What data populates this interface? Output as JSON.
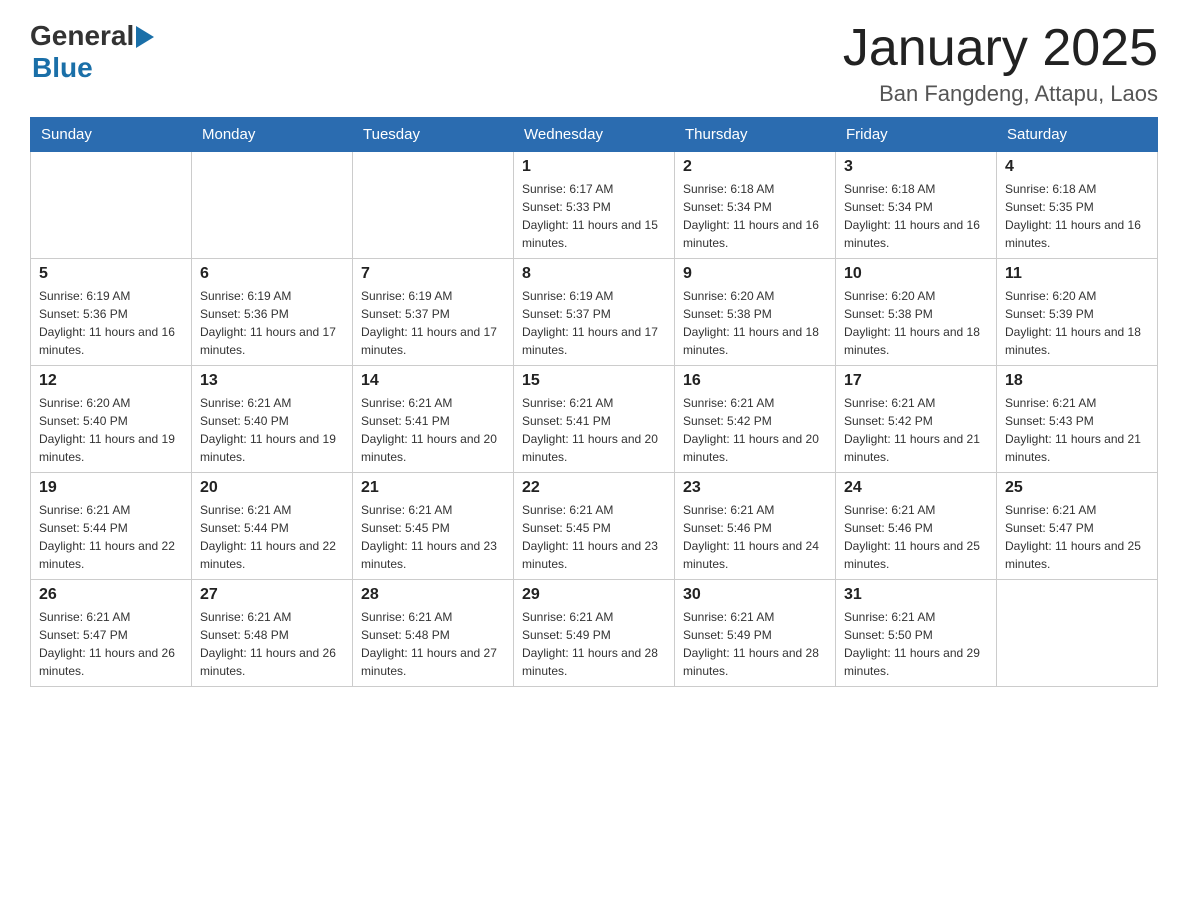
{
  "header": {
    "logo_general": "General",
    "logo_blue": "Blue",
    "month_title": "January 2025",
    "location": "Ban Fangdeng, Attapu, Laos"
  },
  "weekdays": [
    "Sunday",
    "Monday",
    "Tuesday",
    "Wednesday",
    "Thursday",
    "Friday",
    "Saturday"
  ],
  "weeks": [
    [
      {
        "day": "",
        "info": ""
      },
      {
        "day": "",
        "info": ""
      },
      {
        "day": "",
        "info": ""
      },
      {
        "day": "1",
        "info": "Sunrise: 6:17 AM\nSunset: 5:33 PM\nDaylight: 11 hours and 15 minutes."
      },
      {
        "day": "2",
        "info": "Sunrise: 6:18 AM\nSunset: 5:34 PM\nDaylight: 11 hours and 16 minutes."
      },
      {
        "day": "3",
        "info": "Sunrise: 6:18 AM\nSunset: 5:34 PM\nDaylight: 11 hours and 16 minutes."
      },
      {
        "day": "4",
        "info": "Sunrise: 6:18 AM\nSunset: 5:35 PM\nDaylight: 11 hours and 16 minutes."
      }
    ],
    [
      {
        "day": "5",
        "info": "Sunrise: 6:19 AM\nSunset: 5:36 PM\nDaylight: 11 hours and 16 minutes."
      },
      {
        "day": "6",
        "info": "Sunrise: 6:19 AM\nSunset: 5:36 PM\nDaylight: 11 hours and 17 minutes."
      },
      {
        "day": "7",
        "info": "Sunrise: 6:19 AM\nSunset: 5:37 PM\nDaylight: 11 hours and 17 minutes."
      },
      {
        "day": "8",
        "info": "Sunrise: 6:19 AM\nSunset: 5:37 PM\nDaylight: 11 hours and 17 minutes."
      },
      {
        "day": "9",
        "info": "Sunrise: 6:20 AM\nSunset: 5:38 PM\nDaylight: 11 hours and 18 minutes."
      },
      {
        "day": "10",
        "info": "Sunrise: 6:20 AM\nSunset: 5:38 PM\nDaylight: 11 hours and 18 minutes."
      },
      {
        "day": "11",
        "info": "Sunrise: 6:20 AM\nSunset: 5:39 PM\nDaylight: 11 hours and 18 minutes."
      }
    ],
    [
      {
        "day": "12",
        "info": "Sunrise: 6:20 AM\nSunset: 5:40 PM\nDaylight: 11 hours and 19 minutes."
      },
      {
        "day": "13",
        "info": "Sunrise: 6:21 AM\nSunset: 5:40 PM\nDaylight: 11 hours and 19 minutes."
      },
      {
        "day": "14",
        "info": "Sunrise: 6:21 AM\nSunset: 5:41 PM\nDaylight: 11 hours and 20 minutes."
      },
      {
        "day": "15",
        "info": "Sunrise: 6:21 AM\nSunset: 5:41 PM\nDaylight: 11 hours and 20 minutes."
      },
      {
        "day": "16",
        "info": "Sunrise: 6:21 AM\nSunset: 5:42 PM\nDaylight: 11 hours and 20 minutes."
      },
      {
        "day": "17",
        "info": "Sunrise: 6:21 AM\nSunset: 5:42 PM\nDaylight: 11 hours and 21 minutes."
      },
      {
        "day": "18",
        "info": "Sunrise: 6:21 AM\nSunset: 5:43 PM\nDaylight: 11 hours and 21 minutes."
      }
    ],
    [
      {
        "day": "19",
        "info": "Sunrise: 6:21 AM\nSunset: 5:44 PM\nDaylight: 11 hours and 22 minutes."
      },
      {
        "day": "20",
        "info": "Sunrise: 6:21 AM\nSunset: 5:44 PM\nDaylight: 11 hours and 22 minutes."
      },
      {
        "day": "21",
        "info": "Sunrise: 6:21 AM\nSunset: 5:45 PM\nDaylight: 11 hours and 23 minutes."
      },
      {
        "day": "22",
        "info": "Sunrise: 6:21 AM\nSunset: 5:45 PM\nDaylight: 11 hours and 23 minutes."
      },
      {
        "day": "23",
        "info": "Sunrise: 6:21 AM\nSunset: 5:46 PM\nDaylight: 11 hours and 24 minutes."
      },
      {
        "day": "24",
        "info": "Sunrise: 6:21 AM\nSunset: 5:46 PM\nDaylight: 11 hours and 25 minutes."
      },
      {
        "day": "25",
        "info": "Sunrise: 6:21 AM\nSunset: 5:47 PM\nDaylight: 11 hours and 25 minutes."
      }
    ],
    [
      {
        "day": "26",
        "info": "Sunrise: 6:21 AM\nSunset: 5:47 PM\nDaylight: 11 hours and 26 minutes."
      },
      {
        "day": "27",
        "info": "Sunrise: 6:21 AM\nSunset: 5:48 PM\nDaylight: 11 hours and 26 minutes."
      },
      {
        "day": "28",
        "info": "Sunrise: 6:21 AM\nSunset: 5:48 PM\nDaylight: 11 hours and 27 minutes."
      },
      {
        "day": "29",
        "info": "Sunrise: 6:21 AM\nSunset: 5:49 PM\nDaylight: 11 hours and 28 minutes."
      },
      {
        "day": "30",
        "info": "Sunrise: 6:21 AM\nSunset: 5:49 PM\nDaylight: 11 hours and 28 minutes."
      },
      {
        "day": "31",
        "info": "Sunrise: 6:21 AM\nSunset: 5:50 PM\nDaylight: 11 hours and 29 minutes."
      },
      {
        "day": "",
        "info": ""
      }
    ]
  ]
}
